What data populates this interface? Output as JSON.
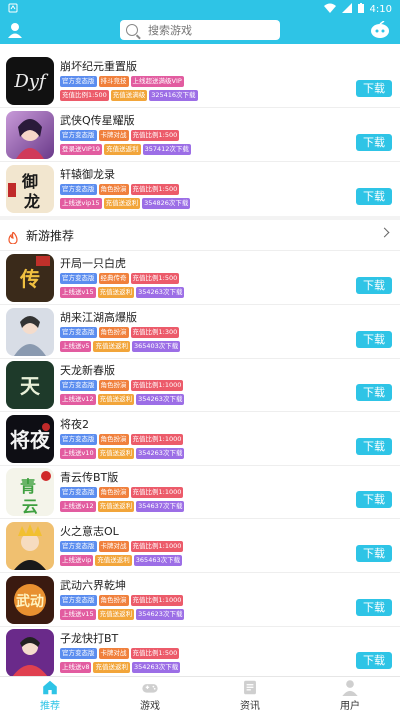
{
  "status_bar": {
    "time": "4:10",
    "left_icon": "notification-icon"
  },
  "search": {
    "placeholder": "搜索游戏"
  },
  "colors": {
    "accent": "#2ec4e6",
    "tag_blue": "#5b8def",
    "tag_orange": "#f0803c",
    "tag_red": "#ec5b6a",
    "tag_pink": "#e25ca0",
    "tag_purple": "#9c6ee6",
    "tag_yellow": "#f2a53a"
  },
  "download_label": "下载",
  "top_games": [
    {
      "name": "崩坏纪元重置版",
      "tags_row1": [
        {
          "text": "官方变态版",
          "color": "blue"
        },
        {
          "text": "排斗竞技",
          "color": "orange"
        },
        {
          "text": "上线超送满级VIP",
          "color": "pink"
        }
      ],
      "tags_row2": [
        {
          "text": "充值比例1:500",
          "color": "red"
        },
        {
          "text": "充值送满级",
          "color": "yellow"
        },
        {
          "text": "325416次下载",
          "color": "purple"
        }
      ]
    },
    {
      "name": "武侠Q传星耀版",
      "tags_row1": [
        {
          "text": "官方变态版",
          "color": "blue"
        },
        {
          "text": "卡牌对战",
          "color": "orange"
        },
        {
          "text": "充值比例1:500",
          "color": "red"
        }
      ],
      "tags_row2": [
        {
          "text": "登录送VIP19",
          "color": "pink"
        },
        {
          "text": "充值送返利",
          "color": "yellow"
        },
        {
          "text": "357412次下载",
          "color": "purple"
        }
      ]
    },
    {
      "name": "轩辕御龙录",
      "tags_row1": [
        {
          "text": "官方变态版",
          "color": "blue"
        },
        {
          "text": "角色扮演",
          "color": "orange"
        },
        {
          "text": "充值比例1:500",
          "color": "red"
        }
      ],
      "tags_row2": [
        {
          "text": "上线送vip15",
          "color": "pink"
        },
        {
          "text": "充值送返利",
          "color": "yellow"
        },
        {
          "text": "354826次下载",
          "color": "purple"
        }
      ]
    }
  ],
  "new_games_section": {
    "title": "新游推荐"
  },
  "new_games": [
    {
      "name": "开局一只白虎",
      "tags_row1": [
        {
          "text": "官方变态版",
          "color": "blue"
        },
        {
          "text": "经典传奇",
          "color": "orange"
        },
        {
          "text": "充值比例1:500",
          "color": "red"
        }
      ],
      "tags_row2": [
        {
          "text": "上线送v15",
          "color": "pink"
        },
        {
          "text": "充值送返利",
          "color": "yellow"
        },
        {
          "text": "354263次下载",
          "color": "purple"
        }
      ]
    },
    {
      "name": "胡来江湖高爆版",
      "tags_row1": [
        {
          "text": "官方变态版",
          "color": "blue"
        },
        {
          "text": "角色扮演",
          "color": "orange"
        },
        {
          "text": "充值比例1:300",
          "color": "red"
        }
      ],
      "tags_row2": [
        {
          "text": "上线送v5",
          "color": "pink"
        },
        {
          "text": "充值送返利",
          "color": "yellow"
        },
        {
          "text": "365403次下载",
          "color": "purple"
        }
      ]
    },
    {
      "name": "天龙新春版",
      "tags_row1": [
        {
          "text": "官方变态版",
          "color": "blue"
        },
        {
          "text": "角色扮演",
          "color": "orange"
        },
        {
          "text": "充值比例1:1000",
          "color": "red"
        }
      ],
      "tags_row2": [
        {
          "text": "上线送v12",
          "color": "pink"
        },
        {
          "text": "充值送返利",
          "color": "yellow"
        },
        {
          "text": "354263次下载",
          "color": "purple"
        }
      ]
    },
    {
      "name": "将夜2",
      "tags_row1": [
        {
          "text": "官方变态版",
          "color": "blue"
        },
        {
          "text": "角色扮演",
          "color": "orange"
        },
        {
          "text": "充值比例1:1000",
          "color": "red"
        }
      ],
      "tags_row2": [
        {
          "text": "上线送v10",
          "color": "pink"
        },
        {
          "text": "充值送返利",
          "color": "yellow"
        },
        {
          "text": "354263次下载",
          "color": "purple"
        }
      ]
    },
    {
      "name": "青云传BT版",
      "tags_row1": [
        {
          "text": "官方变态版",
          "color": "blue"
        },
        {
          "text": "角色扮演",
          "color": "orange"
        },
        {
          "text": "充值比例1:1000",
          "color": "red"
        }
      ],
      "tags_row2": [
        {
          "text": "上线送v12",
          "color": "pink"
        },
        {
          "text": "充值送返利",
          "color": "yellow"
        },
        {
          "text": "354637次下载",
          "color": "purple"
        }
      ]
    },
    {
      "name": "火之意志OL",
      "tags_row1": [
        {
          "text": "官方变态版",
          "color": "blue"
        },
        {
          "text": "卡牌对战",
          "color": "orange"
        },
        {
          "text": "充值比例1:1000",
          "color": "red"
        }
      ],
      "tags_row2": [
        {
          "text": "上线送vip",
          "color": "pink"
        },
        {
          "text": "充值送返利",
          "color": "yellow"
        },
        {
          "text": "365463次下载",
          "color": "purple"
        }
      ]
    },
    {
      "name": "武动六界乾坤",
      "tags_row1": [
        {
          "text": "官方变态版",
          "color": "blue"
        },
        {
          "text": "角色扮演",
          "color": "orange"
        },
        {
          "text": "充值比例1:1000",
          "color": "red"
        }
      ],
      "tags_row2": [
        {
          "text": "上线送v15",
          "color": "pink"
        },
        {
          "text": "充值送返利",
          "color": "yellow"
        },
        {
          "text": "354623次下载",
          "color": "purple"
        }
      ]
    },
    {
      "name": "子龙快打BT",
      "tags_row1": [
        {
          "text": "官方变态版",
          "color": "blue"
        },
        {
          "text": "卡牌对战",
          "color": "orange"
        },
        {
          "text": "充值比例1:500",
          "color": "red"
        }
      ],
      "tags_row2": [
        {
          "text": "上线送v8",
          "color": "pink"
        },
        {
          "text": "充值送返利",
          "color": "yellow"
        },
        {
          "text": "354263次下载",
          "color": "purple"
        }
      ]
    }
  ],
  "bottom_nav": [
    {
      "label": "推荐",
      "icon": "home-icon",
      "active": true
    },
    {
      "label": "游戏",
      "icon": "gamepad-icon",
      "active": false
    },
    {
      "label": "资讯",
      "icon": "news-icon",
      "active": false
    },
    {
      "label": "用户",
      "icon": "user-icon",
      "active": false
    }
  ]
}
